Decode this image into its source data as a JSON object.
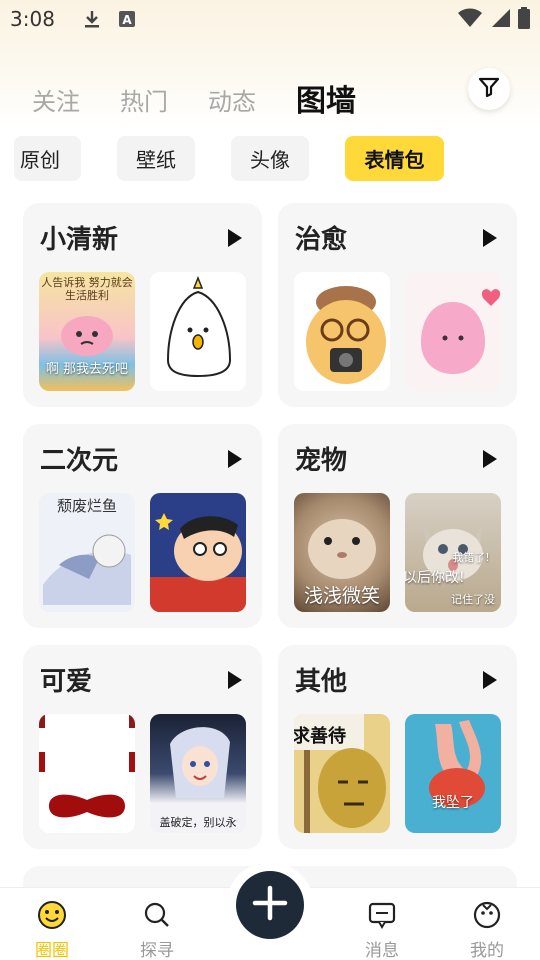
{
  "status": {
    "time": "3:08",
    "icons": [
      "download-icon",
      "a-notification-icon",
      "wifi-icon",
      "signal-icon",
      "battery-icon"
    ]
  },
  "tabs": [
    {
      "label": "关注",
      "active": false
    },
    {
      "label": "热门",
      "active": false
    },
    {
      "label": "动态",
      "active": false
    },
    {
      "label": "图墙",
      "active": true
    }
  ],
  "categories": [
    {
      "label": "原创",
      "active": false
    },
    {
      "label": "壁纸",
      "active": false
    },
    {
      "label": "头像",
      "active": false
    },
    {
      "label": "表情包",
      "active": true
    }
  ],
  "cards": [
    {
      "title": "小清新",
      "thumb_texts": [
        "人告诉我 努力就会 生活胜利",
        "啊 那我去死吧"
      ]
    },
    {
      "title": "治愈",
      "thumb_texts": []
    },
    {
      "title": "二次元",
      "thumb_texts": [
        "颓废烂鱼"
      ]
    },
    {
      "title": "宠物",
      "thumb_texts": [
        "浅浅微笑",
        "我错了!",
        "以后你改!",
        "记住了没"
      ]
    },
    {
      "title": "可爱",
      "thumb_texts": [
        "盖破定，别以永"
      ]
    },
    {
      "title": "其他",
      "thumb_texts": [
        "求善待",
        "我坠了"
      ]
    }
  ],
  "nav": [
    {
      "label": "圈圈",
      "icon": "smiley-face-icon",
      "active": true
    },
    {
      "label": "探寻",
      "icon": "search-icon",
      "active": false
    },
    {
      "label": "消息",
      "icon": "message-icon",
      "active": false
    },
    {
      "label": "我的",
      "icon": "profile-icon",
      "active": false
    }
  ],
  "colors": {
    "accent": "#ffd83a",
    "fab": "#1e2a38",
    "nav_active": "#f5c400"
  }
}
